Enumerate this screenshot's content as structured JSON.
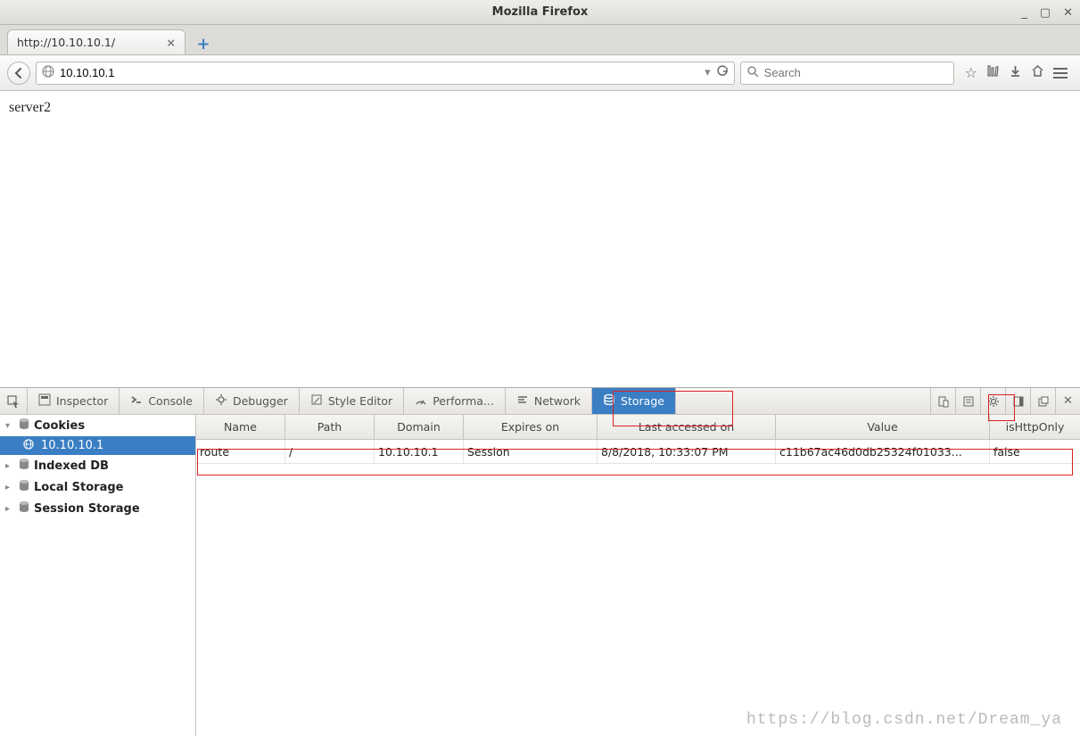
{
  "window": {
    "title": "Mozilla Firefox"
  },
  "tab": {
    "title": "http://10.10.10.1/"
  },
  "url": {
    "value": "10.10.10.1"
  },
  "search": {
    "placeholder": "Search"
  },
  "page": {
    "body": "server2"
  },
  "devtools": {
    "tools": {
      "pick": "",
      "inspector": "Inspector",
      "console": "Console",
      "debugger": "Debugger",
      "style_editor": "Style Editor",
      "performance": "Performa...",
      "network": "Network",
      "storage": "Storage"
    },
    "sidebar": {
      "cookies": "Cookies",
      "cookies_host": "10.10.10.1",
      "indexed_db": "Indexed DB",
      "local_storage": "Local Storage",
      "session_storage": "Session Storage"
    },
    "columns": {
      "name": "Name",
      "path": "Path",
      "domain": "Domain",
      "expires": "Expires on",
      "last_accessed": "Last accessed on",
      "value": "Value",
      "httponly": "isHttpOnly"
    },
    "rows": [
      {
        "name": "route",
        "path": "/",
        "domain": "10.10.10.1",
        "expires": "Session",
        "last_accessed": "8/8/2018, 10:33:07 PM",
        "value": "c11b67ac46d0db25324f01033...",
        "httponly": "false"
      }
    ]
  },
  "colwidths": {
    "name": 100,
    "path": 100,
    "domain": 100,
    "expires": 150,
    "last_accessed": 200,
    "value": 240,
    "httponly": 97
  },
  "watermark": "https://blog.csdn.net/Dream_ya"
}
